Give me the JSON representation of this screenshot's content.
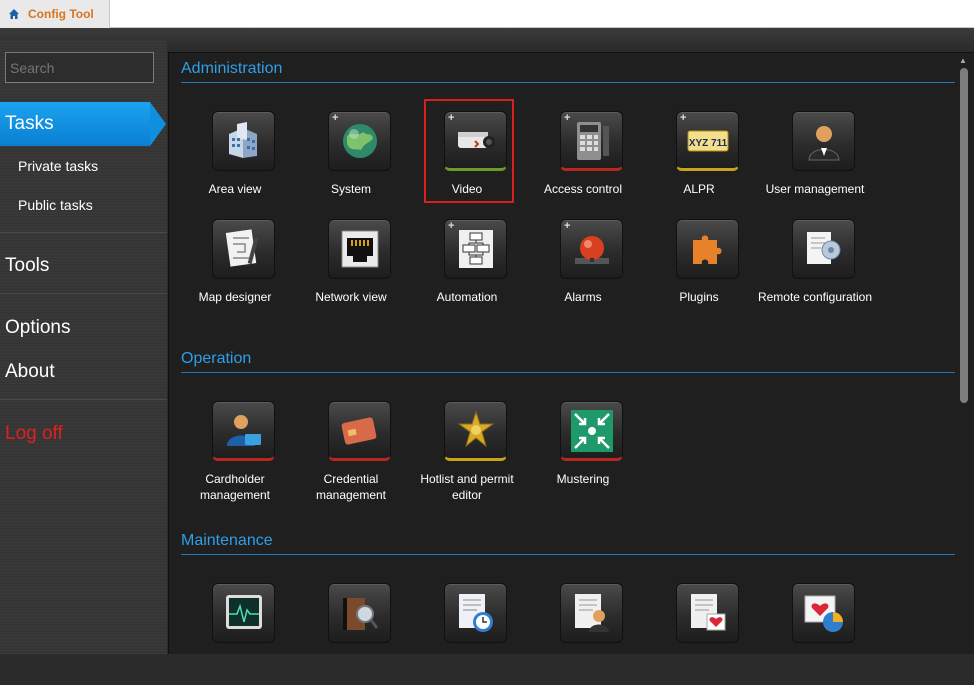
{
  "app": {
    "tab_label": "Config Tool"
  },
  "sidebar": {
    "search_placeholder": "Search",
    "items": [
      {
        "label": "Tasks",
        "active": true
      },
      {
        "label": "Private tasks"
      },
      {
        "label": "Public tasks"
      },
      {
        "label": "Tools"
      },
      {
        "label": "Options"
      },
      {
        "label": "About"
      },
      {
        "label": "Log off"
      }
    ]
  },
  "sections": {
    "administration": {
      "title": "Administration",
      "tiles": [
        {
          "label": "Area view",
          "icon": "building-icon"
        },
        {
          "label": "System",
          "icon": "globe-icon"
        },
        {
          "label": "Video",
          "icon": "camera-icon"
        },
        {
          "label": "Access control",
          "icon": "keypad-icon"
        },
        {
          "label": "ALPR",
          "icon": "license-plate-icon",
          "plate": "XYZ 711"
        },
        {
          "label": "User management",
          "icon": "user-icon"
        },
        {
          "label": "Map designer",
          "icon": "map-designer-icon"
        },
        {
          "label": "Network view",
          "icon": "network-port-icon"
        },
        {
          "label": "Automation",
          "icon": "flowchart-icon"
        },
        {
          "label": "Alarms",
          "icon": "alarm-bell-icon"
        },
        {
          "label": "Plugins",
          "icon": "puzzle-icon"
        },
        {
          "label": "Remote configuration",
          "icon": "remote-config-icon"
        }
      ]
    },
    "operation": {
      "title": "Operation",
      "tiles": [
        {
          "label": "Cardholder management",
          "icon": "cardholder-icon"
        },
        {
          "label": "Credential management",
          "icon": "credential-icon"
        },
        {
          "label": "Hotlist and permit editor",
          "icon": "sheriff-badge-icon"
        },
        {
          "label": "Mustering",
          "icon": "mustering-icon"
        }
      ]
    },
    "maintenance": {
      "title": "Maintenance",
      "tiles": [
        {
          "label": "",
          "icon": "monitor-icon"
        },
        {
          "label": "",
          "icon": "search-book-icon"
        },
        {
          "label": "",
          "icon": "schedule-report-icon"
        },
        {
          "label": "",
          "icon": "user-report-icon"
        },
        {
          "label": "",
          "icon": "health-report-icon"
        },
        {
          "label": "",
          "icon": "statistics-icon"
        }
      ]
    }
  },
  "colors": {
    "accent": "#2f9fe8",
    "active_nav": "#1aa3f0",
    "logoff": "#e0201e",
    "highlight_box": "#d81e1e"
  }
}
